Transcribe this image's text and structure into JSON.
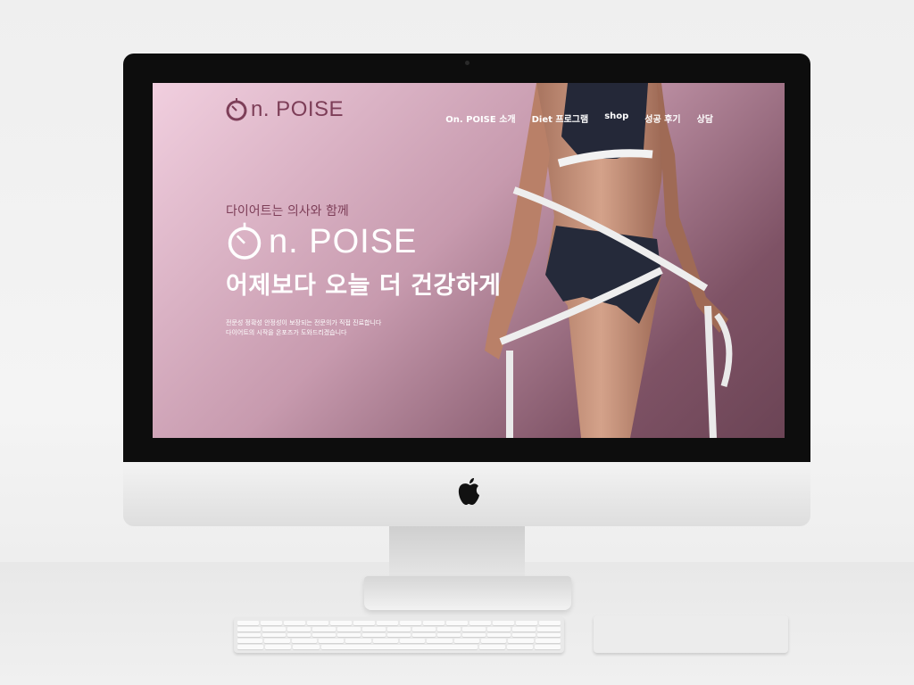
{
  "logo": {
    "brand": "On. POISE",
    "text": "n. POISE",
    "icon": "stopwatch-o-icon",
    "color": "#7d3e58"
  },
  "nav": {
    "items": [
      {
        "label": "On. POISE 소개"
      },
      {
        "label": "Diet 프로그램"
      },
      {
        "label": "shop"
      },
      {
        "label": "성공 후기"
      },
      {
        "label": "상담"
      }
    ]
  },
  "hero": {
    "tagline": "다이어트는 의사와 함께",
    "big_logo_text": "n. POISE",
    "headline": "어제보다 오늘 더 건강하게",
    "desc_line1": "전문성 정확성 안정성이 보장되는 전문의가 직접 진료합니다",
    "desc_line2": "다이어트의 시작을 온포즈가 도와드리겠습니다",
    "photo": "woman-measuring-waist-image"
  },
  "device": {
    "apple_logo": "apple-icon",
    "bezel_color": "#0d0d0d",
    "screen_gradient_start": "#f1cfdf",
    "screen_gradient_end": "#6b4455"
  }
}
